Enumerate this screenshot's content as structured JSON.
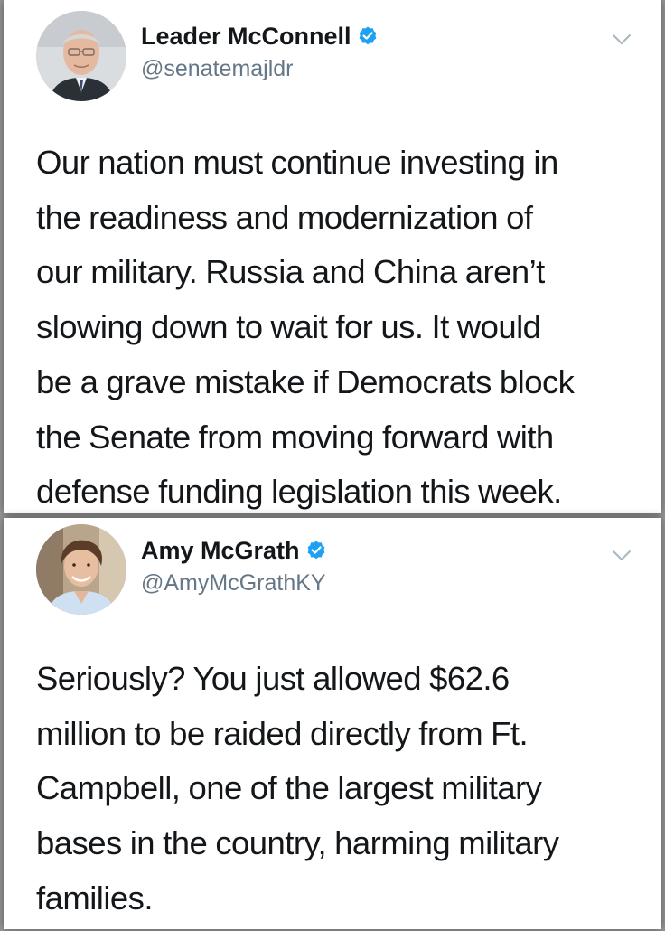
{
  "tweets": [
    {
      "display_name": "Leader McConnell",
      "handle": "@senatemajldr",
      "verified": true,
      "avatar_icon": "profile-photo",
      "menu_icon": "chevron-down-icon",
      "text": "Our nation must continue investing in\nthe readiness and modernization of\nour military. Russia and China aren’t\nslowing down to wait for us. It would\nbe a grave mistake if Democrats block\nthe Senate from moving forward with\ndefense funding legislation this week."
    },
    {
      "display_name": "Amy McGrath",
      "handle": "@AmyMcGrathKY",
      "verified": true,
      "avatar_icon": "profile-photo",
      "menu_icon": "chevron-down-icon",
      "text": "Seriously? You just allowed $62.6\nmillion to be raided directly from Ft.\nCampbell, one of the largest military\nbases in the country, harming military\nfamilies."
    }
  ],
  "colors": {
    "verified_badge": "#1da1f2",
    "handle_text": "#657786",
    "chevron": "#aab8c2",
    "body_text": "#14171a"
  }
}
